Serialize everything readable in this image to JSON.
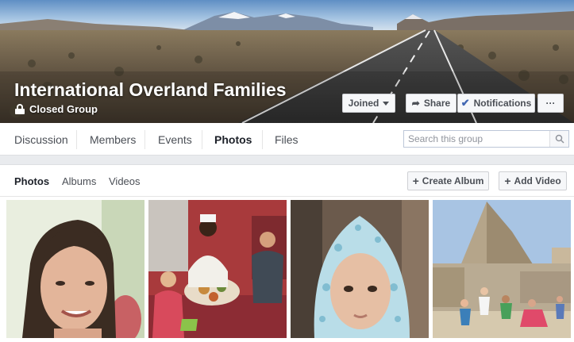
{
  "cover": {
    "group_name": "International Overland Families",
    "privacy": "Closed Group",
    "buttons": {
      "joined": "Joined",
      "share": "Share",
      "notifications": "Notifications",
      "more": "···"
    }
  },
  "nav": {
    "tabs": [
      "Discussion",
      "Members",
      "Events",
      "Photos",
      "Files"
    ],
    "active_tab": "Photos",
    "search_placeholder": "Search this group"
  },
  "photos_section": {
    "subtabs": [
      "Photos",
      "Albums",
      "Videos"
    ],
    "active_subtab": "Photos",
    "create_album": "Create Album",
    "add_video": "Add Video"
  },
  "colors": {
    "accent": "#4267b2",
    "page_bg": "#e9ebee",
    "button_bg": "#f6f7f9"
  },
  "icons": [
    "lock-icon",
    "caret-down-icon",
    "share-arrow-icon",
    "checkmark-icon",
    "search-icon",
    "plus-icon"
  ]
}
